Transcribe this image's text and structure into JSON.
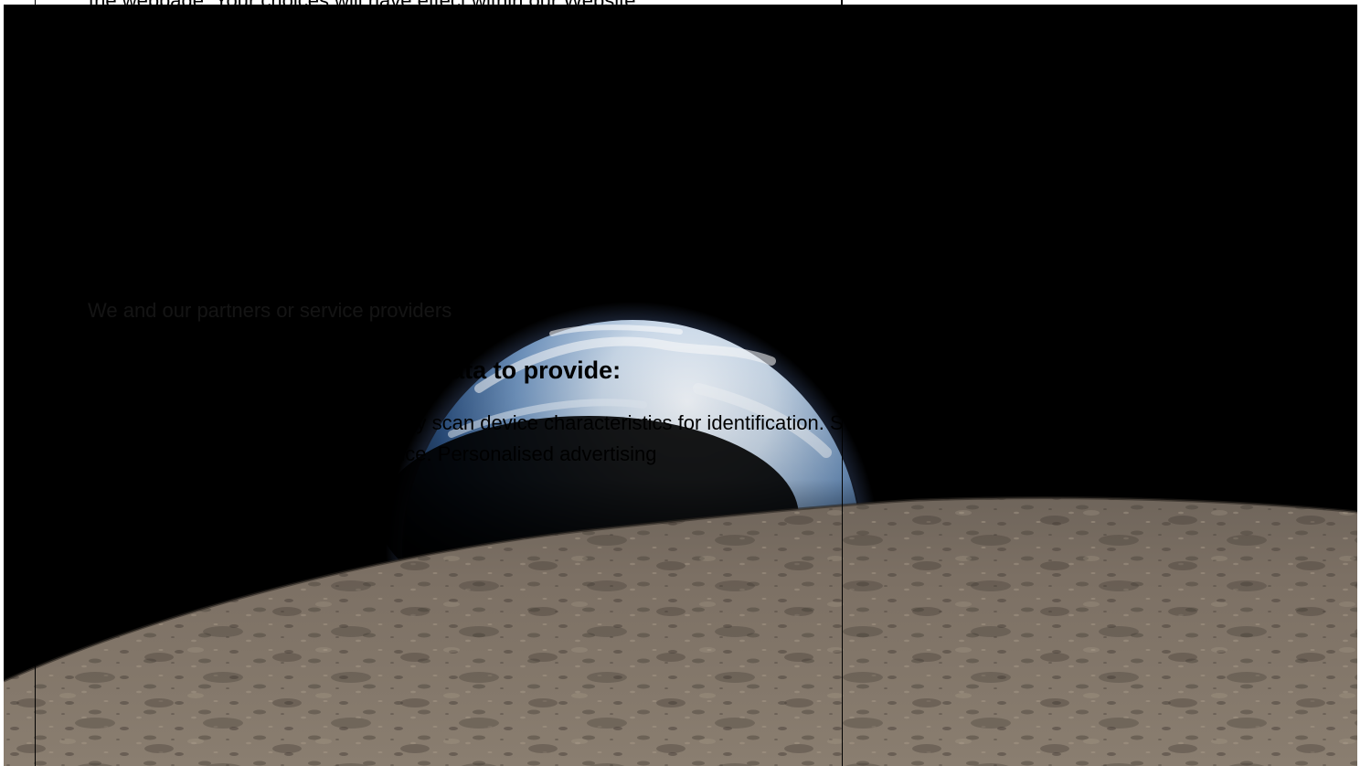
{
  "consent": {
    "top_line": "the webpage. Your choices will have effect within our Website.",
    "provider_line": "We and our partners or service providers",
    "heading": "We and our partners process data to provide:",
    "purposes_line_1": "Use precise geolocation data. Actively scan device characteristics for identification. Store",
    "purposes_line_2": "and/or access information on a device. Personalised advertising"
  },
  "hero": {
    "icon": "earthrise-image",
    "colors": {
      "space": "#000000",
      "earth_ocean": "#3c6ea8",
      "earth_cloud": "#eef3f8",
      "moon_surface": "#7a6e62"
    }
  }
}
